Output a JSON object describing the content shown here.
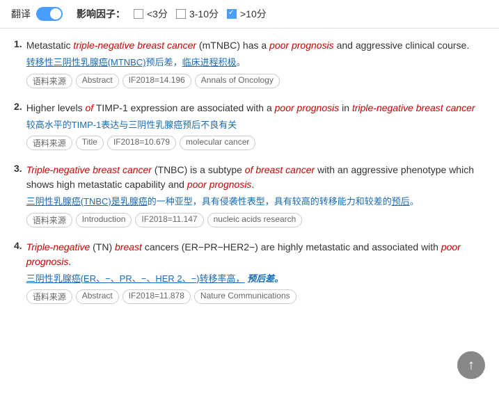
{
  "topbar": {
    "translate_label": "翻译",
    "impact_label": "影响因子：",
    "options": [
      {
        "label": "<3分",
        "checked": false
      },
      {
        "label": "3-10分",
        "checked": false
      },
      {
        "label": ">10分",
        "checked": true
      }
    ]
  },
  "results": [
    {
      "number": "1.",
      "en_parts": [
        {
          "text": "Metastatic ",
          "style": "normal"
        },
        {
          "text": "triple-negative breast cancer",
          "style": "italic-red"
        },
        {
          "text": " (mTNBC) has a ",
          "style": "normal"
        },
        {
          "text": "poor prognosis",
          "style": "italic-red"
        },
        {
          "text": " and aggressive clinical course.",
          "style": "normal"
        }
      ],
      "zh_parts": [
        {
          "text": "转移性三阴性乳腺癌(MTNBC)",
          "style": "underline-blue"
        },
        {
          "text": "预后差，",
          "style": "normal-blue"
        },
        {
          "text": "临床进程积极",
          "style": "underline-blue"
        },
        {
          "text": "。",
          "style": "normal-blue"
        }
      ],
      "tags": [
        "语料来源",
        "Abstract",
        "IF2018=14.196",
        "Annals of Oncology"
      ]
    },
    {
      "number": "2.",
      "en_parts": [
        {
          "text": "Higher levels ",
          "style": "normal"
        },
        {
          "text": "of",
          "style": "italic-red"
        },
        {
          "text": " TIMP-1 expression are associated with a ",
          "style": "normal"
        },
        {
          "text": "poor prognosis",
          "style": "italic-red"
        },
        {
          "text": " in ",
          "style": "normal"
        },
        {
          "text": "triple-negative breast cancer",
          "style": "italic-red"
        }
      ],
      "zh_parts": [
        {
          "text": "较高水平的TIMP-1表达与三阴性乳腺癌预后不良有关",
          "style": "normal-blue"
        }
      ],
      "tags": [
        "语料来源",
        "Title",
        "IF2018=10.679",
        "molecular cancer"
      ]
    },
    {
      "number": "3.",
      "en_parts": [
        {
          "text": "Triple-negative breast cancer",
          "style": "italic-red"
        },
        {
          "text": " (TNBC) is a subtype ",
          "style": "normal"
        },
        {
          "text": "of breast cancer",
          "style": "italic-red"
        },
        {
          "text": " with an aggressive phenotype which shows high metastatic capability and ",
          "style": "normal"
        },
        {
          "text": "poor prognosis",
          "style": "italic-red"
        },
        {
          "text": ".",
          "style": "normal"
        }
      ],
      "zh_parts": [
        {
          "text": "三阴性乳腺癌(TNBC)是乳腺癌",
          "style": "underline-blue"
        },
        {
          "text": "的一种亚型，具有侵袭性表型，具有较高的转移能力和较差的预后。",
          "style": "normal-blue"
        }
      ],
      "tags": [
        "语料来源",
        "Introduction",
        "IF2018=11.147",
        "nucleic acids research"
      ]
    },
    {
      "number": "4.",
      "en_parts": [
        {
          "text": "Triple-negative",
          "style": "italic-red"
        },
        {
          "text": " (TN) ",
          "style": "normal"
        },
        {
          "text": "breast",
          "style": "italic-red"
        },
        {
          "text": " cancers (ER−PR−HER2−) are highly metastatic and associated with ",
          "style": "normal"
        },
        {
          "text": "poor prognosis",
          "style": "italic-red"
        },
        {
          "text": ".",
          "style": "normal"
        }
      ],
      "zh_parts": [
        {
          "text": "三阴性乳腺癌(ER、−、PR、−、HER 2、−)转移率高，",
          "style": "underline-blue"
        },
        {
          "text": " 预后差。",
          "style": "italic-blue-bold"
        }
      ],
      "tags": [
        "语料来源",
        "Abstract",
        "IF2018=11.878",
        "Nature Communications"
      ]
    }
  ],
  "scroll_top_icon": "↑"
}
